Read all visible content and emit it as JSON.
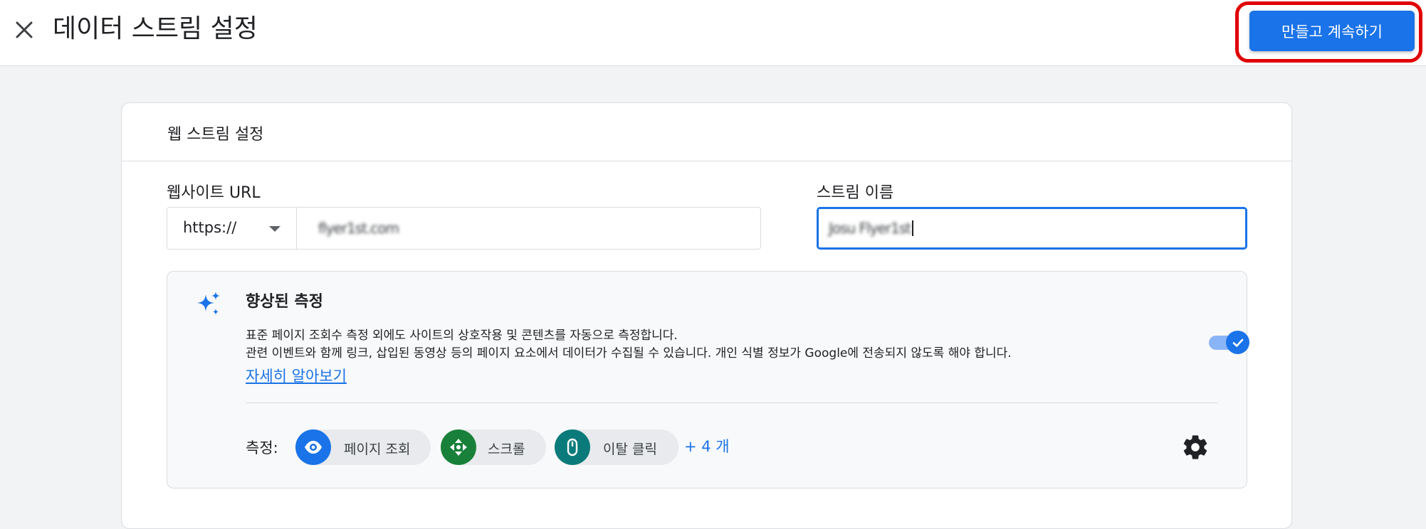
{
  "header": {
    "close_icon": "close-icon",
    "title": "데이터 스트림 설정",
    "primary_button": "만들고 계속하기"
  },
  "card": {
    "title": "웹 스트림 설정",
    "website_url": {
      "label": "웹사이트 URL",
      "protocol": "https://",
      "value": "flyer1st.com"
    },
    "stream_name": {
      "label": "스트림 이름",
      "value": "Josu Flyer1st"
    },
    "enhanced_measurement": {
      "icon": "sparkle-icon",
      "title": "향상된 측정",
      "description_line1": "표준 페이지 조회수 측정 외에도 사이트의 상호작용 및 콘텐츠를 자동으로 측정합니다.",
      "description_line2": "관련 이벤트와 함께 링크, 삽입된 동영상 등의 페이지 요소에서 데이터가 수집될 수 있습니다. 개인 식별 정보가 Google에 전송되지 않도록 해야 합니다.",
      "learn_more": "자세히 알아보기",
      "toggle_enabled": true,
      "measurements_label": "측정:",
      "chips": [
        {
          "label": "페이지 조회",
          "icon": "eye-icon",
          "color": "#1a73e8"
        },
        {
          "label": "스크롤",
          "icon": "scroll-arrows-icon",
          "color": "#188038"
        },
        {
          "label": "이탈 클릭",
          "icon": "mouse-icon",
          "color": "#0b7a7a"
        }
      ],
      "more": "+ 4 개"
    }
  },
  "colors": {
    "accent": "#1a73e8",
    "highlight_border": "#e00000"
  }
}
